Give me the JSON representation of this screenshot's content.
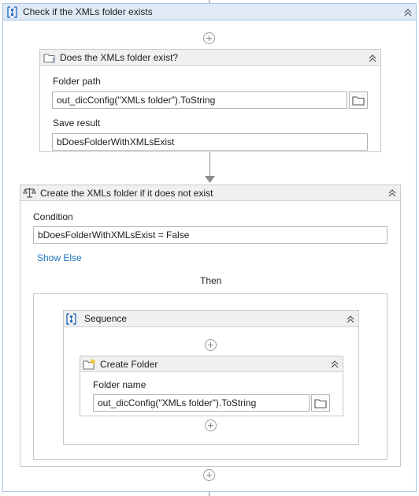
{
  "outer_sequence": {
    "title": "Check if the XMLs folder exists",
    "icon": "sequence-icon"
  },
  "folder_exists_activity": {
    "title": "Does the XMLs folder exist?",
    "icon": "folder-question-icon",
    "folder_path_label": "Folder path",
    "folder_path_value": "out_dicConfig(\"XMLs folder\").ToString",
    "save_result_label": "Save result",
    "save_result_value": "bDoesFolderWithXMLsExist"
  },
  "if_activity": {
    "title": "Create the XMLs folder if it does not exist",
    "icon": "scale-icon",
    "condition_label": "Condition",
    "condition_value": "bDoesFolderWithXMLsExist = False",
    "show_else_label": "Show Else",
    "then_label": "Then"
  },
  "inner_sequence": {
    "title": "Sequence",
    "icon": "sequence-icon"
  },
  "create_folder_activity": {
    "title": "Create Folder",
    "icon": "folder-plus-icon",
    "folder_name_label": "Folder name",
    "folder_name_value": "out_dicConfig(\"XMLs folder\").ToString"
  },
  "colors": {
    "outer_header_bg": "#dfeaf6",
    "outer_header_border": "#a9c4e4",
    "activity_header_bg": "#f0f0f0",
    "link_color": "#1e73be",
    "icon_blue": "#2d6fc1",
    "folder_yellow": "#f2c744"
  }
}
